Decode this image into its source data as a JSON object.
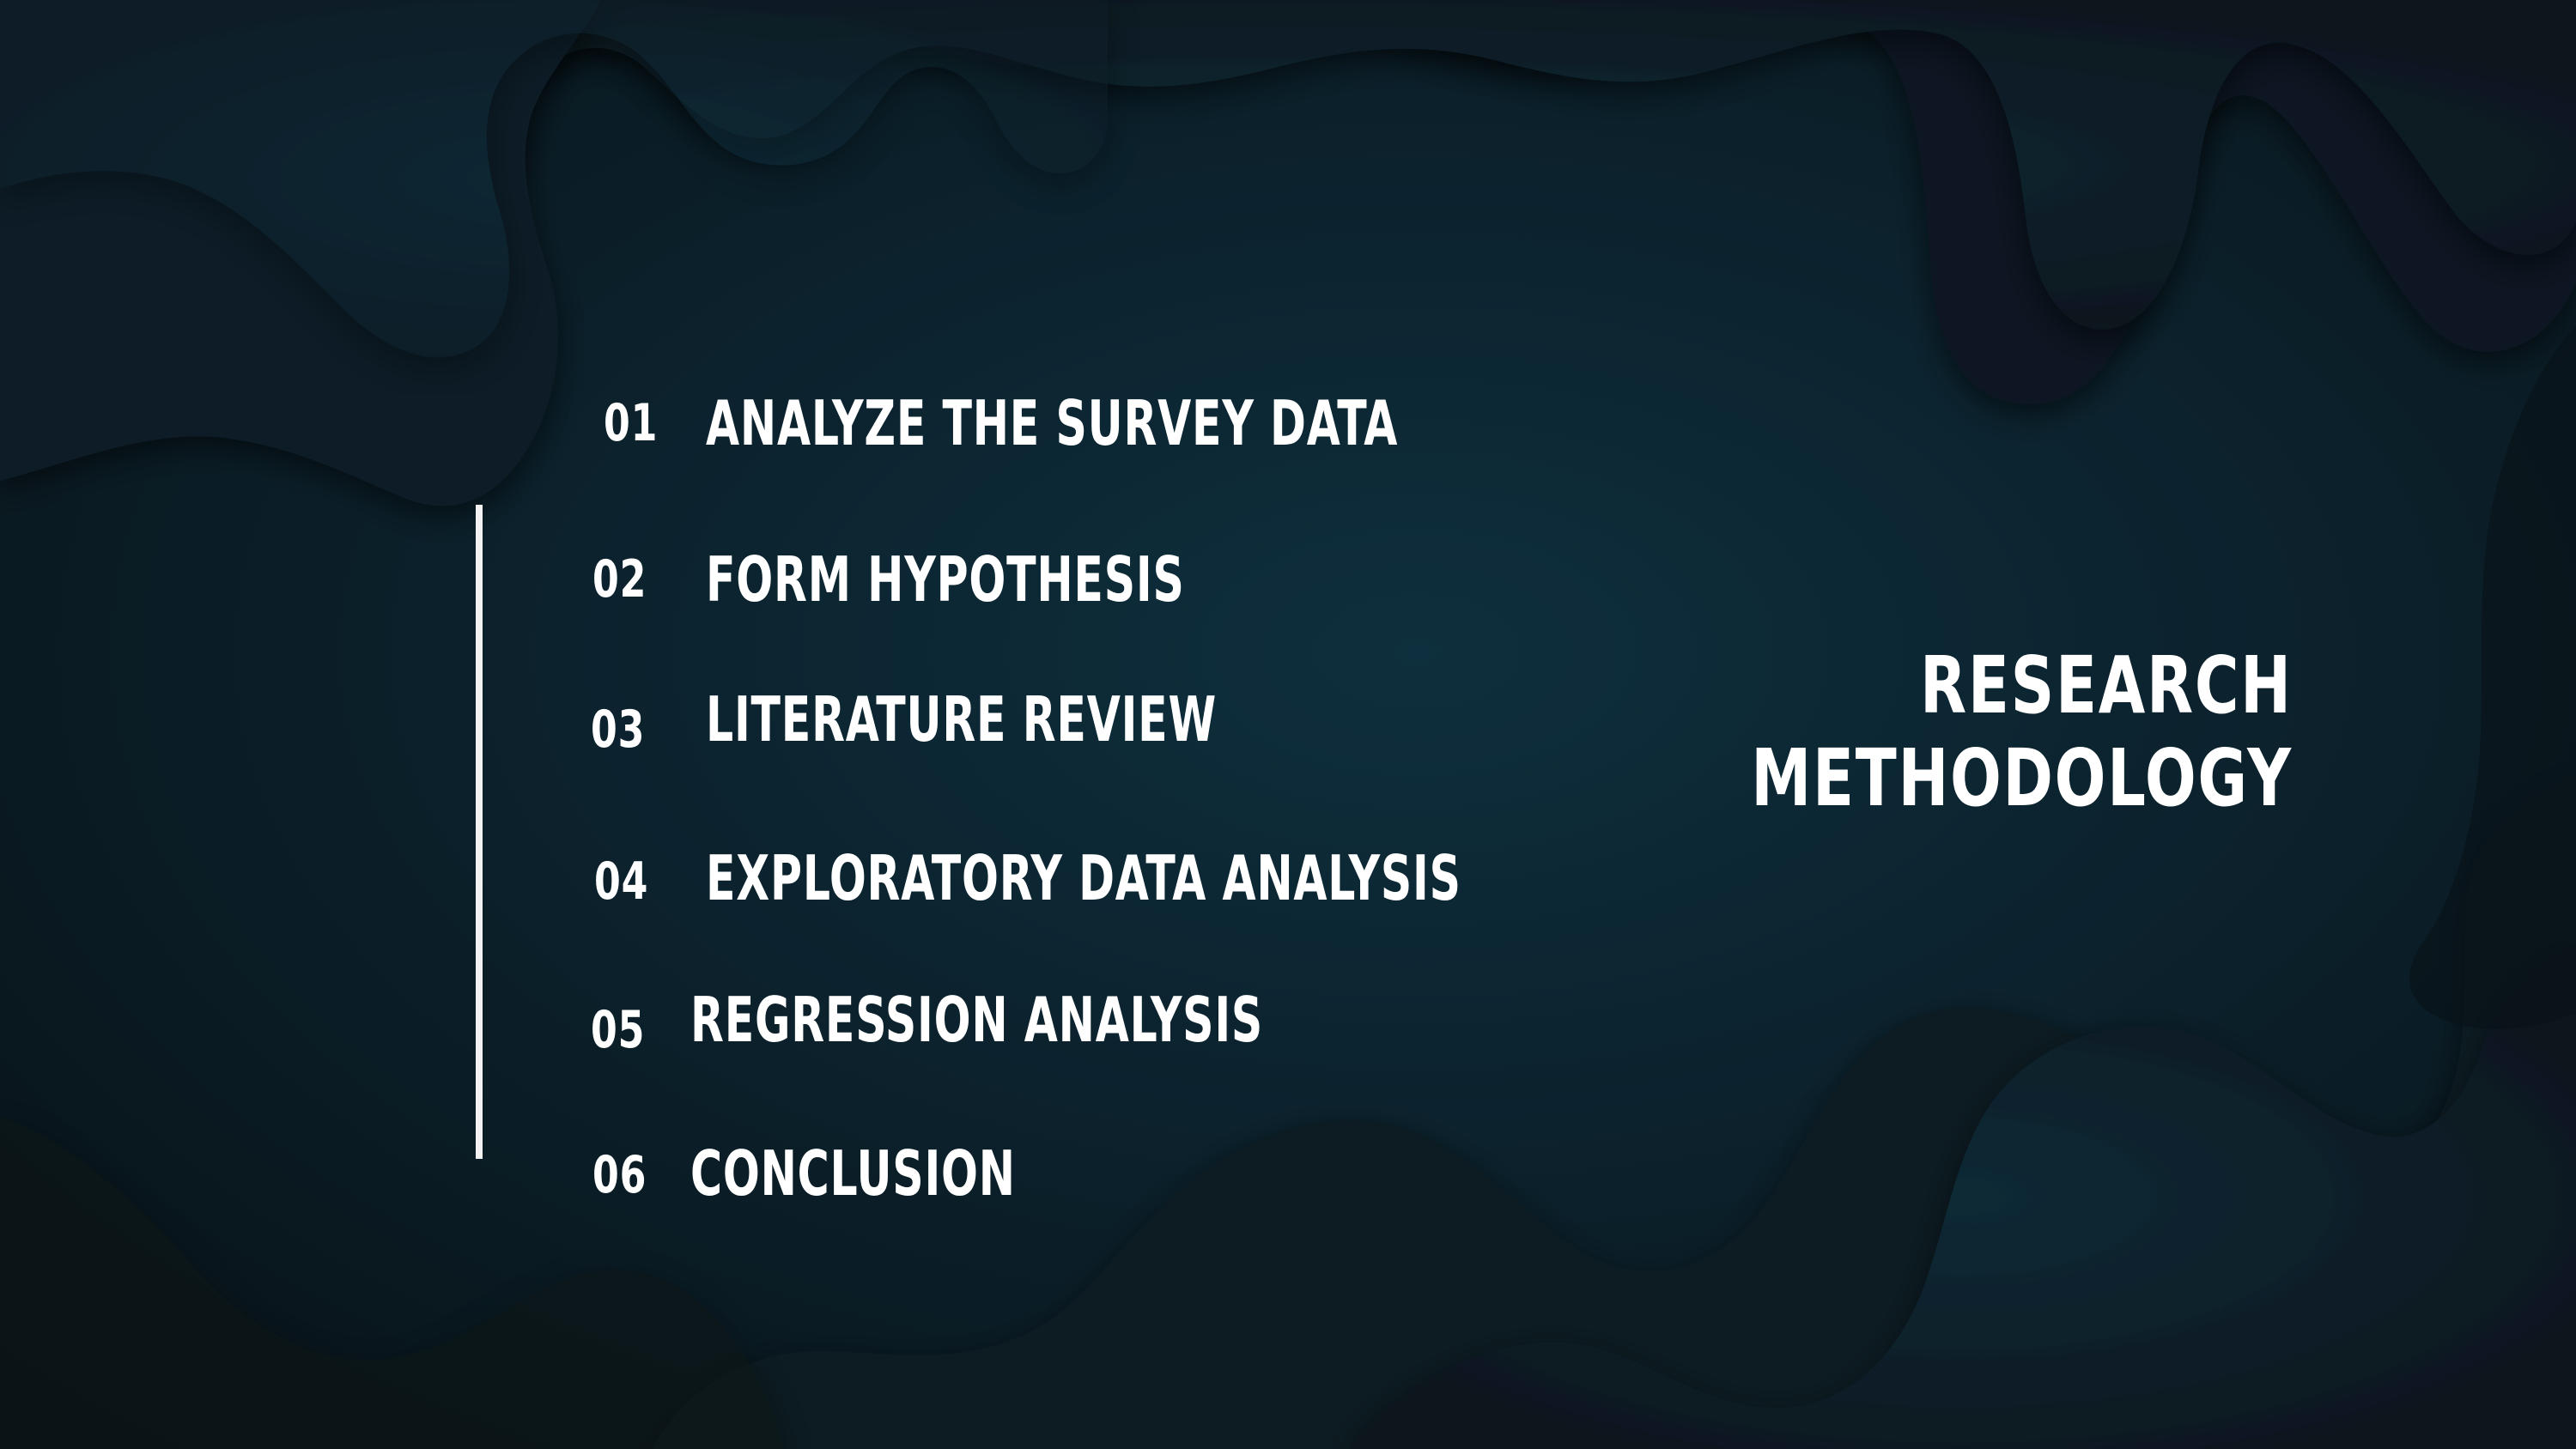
{
  "slide": {
    "title_line1": "RESEARCH",
    "title_line2": "METHODOLOGY",
    "items": [
      {
        "number": "01",
        "label": "ANALYZE THE SURVEY DATA"
      },
      {
        "number": "02",
        "label": "FORM HYPOTHESIS"
      },
      {
        "number": "03",
        "label": "LITERATURE REVIEW"
      },
      {
        "number": "04",
        "label": "EXPLORATORY DATA ANALYSIS"
      },
      {
        "number": "05",
        "label": "REGRESSION ANALYSIS"
      },
      {
        "number": "06",
        "label": "CONCLUSION"
      }
    ]
  },
  "colors": {
    "background": "#0c2430",
    "text": "#ffffff",
    "line": "#f2f2f2"
  }
}
